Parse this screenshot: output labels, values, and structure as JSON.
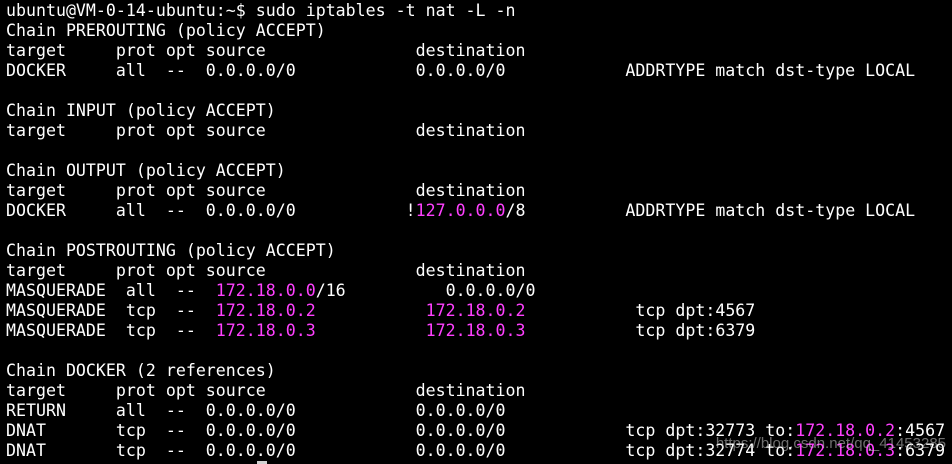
{
  "terminal": {
    "lines": [
      [
        {
          "t": "ubuntu@VM-0-14-ubuntu:~$ sudo iptables -t nat -L -n"
        }
      ],
      [
        {
          "t": "Chain PREROUTING (policy ACCEPT)"
        }
      ],
      [
        {
          "t": "target     prot opt source               destination"
        }
      ],
      [
        {
          "t": "DOCKER     all  --  0.0.0.0/0            0.0.0.0/0            ADDRTYPE match dst-type LOCAL"
        }
      ],
      [
        {
          "t": ""
        }
      ],
      [
        {
          "t": "Chain INPUT (policy ACCEPT)"
        }
      ],
      [
        {
          "t": "target     prot opt source               destination"
        }
      ],
      [
        {
          "t": ""
        }
      ],
      [
        {
          "t": "Chain OUTPUT (policy ACCEPT)"
        }
      ],
      [
        {
          "t": "target     prot opt source               destination"
        }
      ],
      [
        {
          "t": "DOCKER     all  --  0.0.0.0/0           !"
        },
        {
          "t": "127.0.0.0",
          "hl": true
        },
        {
          "t": "/8          ADDRTYPE match dst-type LOCAL"
        }
      ],
      [
        {
          "t": ""
        }
      ],
      [
        {
          "t": "Chain POSTROUTING (policy ACCEPT)"
        }
      ],
      [
        {
          "t": "target     prot opt source               destination"
        }
      ],
      [
        {
          "t": "MASQUERADE  all  --  "
        },
        {
          "t": "172.18.0.0",
          "hl": true
        },
        {
          "t": "/16          0.0.0.0/0"
        }
      ],
      [
        {
          "t": "MASQUERADE  tcp  --  "
        },
        {
          "t": "172.18.0.2",
          "hl": true
        },
        {
          "t": "           "
        },
        {
          "t": "172.18.0.2",
          "hl": true
        },
        {
          "t": "           tcp dpt:4567"
        }
      ],
      [
        {
          "t": "MASQUERADE  tcp  --  "
        },
        {
          "t": "172.18.0.3",
          "hl": true
        },
        {
          "t": "           "
        },
        {
          "t": "172.18.0.3",
          "hl": true
        },
        {
          "t": "           tcp dpt:6379"
        }
      ],
      [
        {
          "t": ""
        }
      ],
      [
        {
          "t": "Chain DOCKER (2 references)"
        }
      ],
      [
        {
          "t": "target     prot opt source               destination"
        }
      ],
      [
        {
          "t": "RETURN     all  --  0.0.0.0/0            0.0.0.0/0"
        }
      ],
      [
        {
          "t": "DNAT       tcp  --  0.0.0.0/0            0.0.0.0/0            tcp dpt:32773 to:"
        },
        {
          "t": "172.18.0.2",
          "hl": true
        },
        {
          "t": ":4567"
        }
      ],
      [
        {
          "t": "DNAT       tcp  --  0.0.0.0/0            0.0.0.0/0            tcp dpt:32774 to:"
        },
        {
          "t": "172.18.0.3",
          "hl": true
        },
        {
          "t": ":6379"
        }
      ]
    ]
  },
  "colors": {
    "background": "#000000",
    "text": "#ffffff",
    "ip_highlight": "#ff40ff"
  },
  "watermark": "https://blog.csdn.net/qq_41453285"
}
